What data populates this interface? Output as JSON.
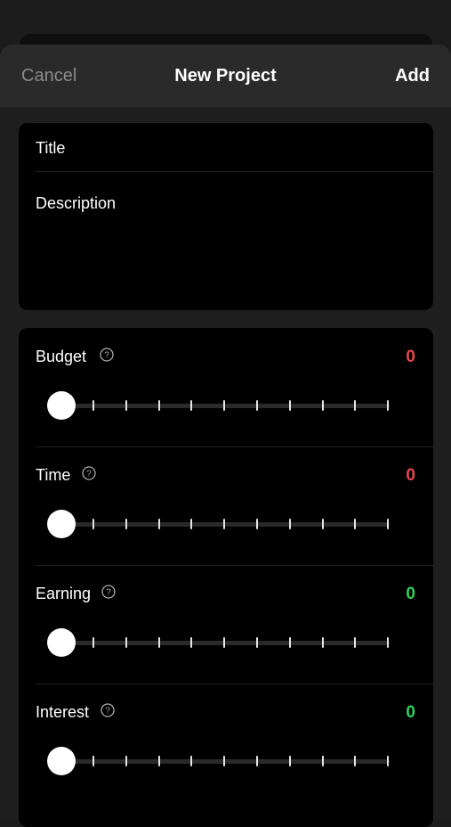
{
  "nav": {
    "cancel": "Cancel",
    "title": "New Project",
    "add": "Add"
  },
  "form": {
    "title_label": "Title",
    "description_label": "Description"
  },
  "sliders": [
    {
      "label": "Budget",
      "value": "0",
      "value_color": "#e5484d"
    },
    {
      "label": "Time",
      "value": "0",
      "value_color": "#e5484d"
    },
    {
      "label": "Earning",
      "value": "0",
      "value_color": "#30d158"
    },
    {
      "label": "Interest",
      "value": "0",
      "value_color": "#30d158"
    }
  ],
  "icons": {
    "help": "question-circle-icon"
  },
  "colors": {
    "background": "#1c1c1c",
    "card": "#000000",
    "nav": "#2a2a2a",
    "negative": "#e5484d",
    "positive": "#30d158"
  }
}
